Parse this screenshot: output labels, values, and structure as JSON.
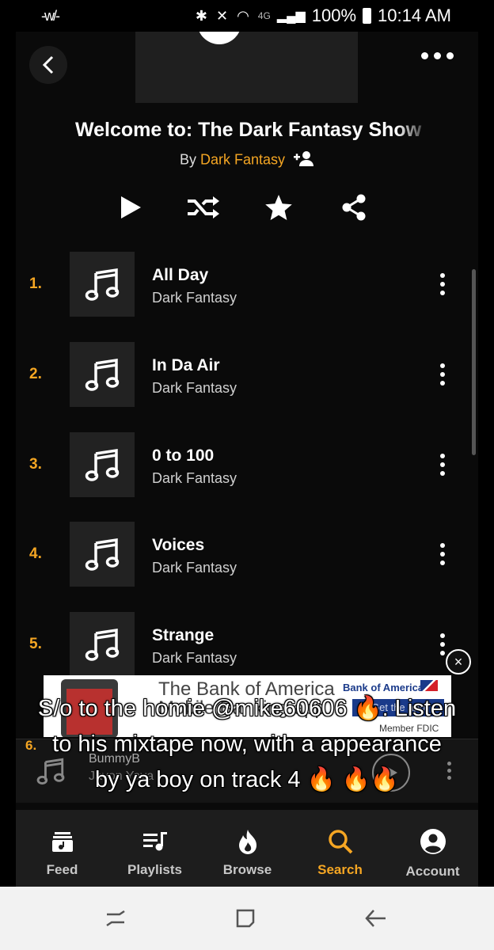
{
  "status_bar": {
    "signal_text": "-w/-",
    "network_label": "4G",
    "battery": "100%",
    "time": "10:14 AM"
  },
  "playlist": {
    "title": "Welcome to: The Dark Fantasy Show",
    "by_prefix": "By",
    "artist": "Dark Fantasy"
  },
  "tracks": [
    {
      "number": "1.",
      "title": "All Day",
      "artist": "Dark Fantasy"
    },
    {
      "number": "2.",
      "title": "In Da Air",
      "artist": "Dark Fantasy"
    },
    {
      "number": "3.",
      "title": "0 to 100",
      "artist": "Dark Fantasy"
    },
    {
      "number": "4.",
      "title": "Voices",
      "artist": "Dark Fantasy"
    },
    {
      "number": "5.",
      "title": "Strange",
      "artist": "Dark Fantasy"
    }
  ],
  "ad": {
    "headline_line1": "The Bank of America",
    "headline_line2": "Mobile Banking app",
    "brand": "Bank of America",
    "cta": "Get the app",
    "member": "Member FDIC",
    "close_icon": "×"
  },
  "now_playing": {
    "track_number": "6.",
    "user": "BummyB",
    "subtitle": "Javon Yaya"
  },
  "caption": {
    "line1": "S/o to the homie @mike60606 🔥. Listen",
    "line2": "to his mixtape now, with a appearance",
    "line3": "by ya boy on track 4 🔥 🔥🔥"
  },
  "bottom_nav": [
    {
      "label": "Feed",
      "icon": "feed-icon",
      "active": false
    },
    {
      "label": "Playlists",
      "icon": "playlists-icon",
      "active": false
    },
    {
      "label": "Browse",
      "icon": "browse-flame-icon",
      "active": false
    },
    {
      "label": "Search",
      "icon": "search-icon",
      "active": true
    },
    {
      "label": "Account",
      "icon": "account-icon",
      "active": false
    }
  ],
  "colors": {
    "accent": "#f5a623",
    "background": "#0a0a0a",
    "nav_background": "#1d1d1d"
  }
}
